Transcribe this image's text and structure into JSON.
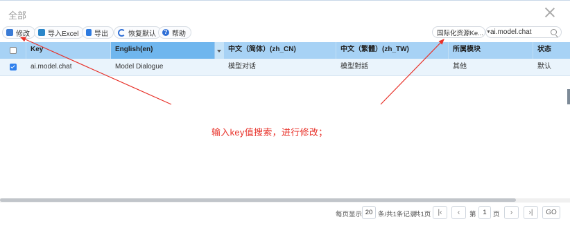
{
  "dialog": {
    "title": "全部"
  },
  "toolbar": {
    "edit": "修改",
    "import": "导入Excel",
    "export": "导出",
    "restore": "恢复默认",
    "help": "帮助"
  },
  "search": {
    "type_select": "国际化资源Ke...",
    "query": "ai.model.chat"
  },
  "table": {
    "headers": [
      "Key",
      "English(en)",
      "中文（简体）(zh_CN)",
      "中文（繁體）(zh_TW)",
      "所属模块",
      "状态"
    ],
    "rows": [
      {
        "checked": true,
        "cells": [
          "ai.model.chat",
          "Model Dialogue",
          "模型对话",
          "模型對話",
          "其他",
          "默认"
        ]
      }
    ]
  },
  "annotation": {
    "text": "输入key值搜索，进行修改；",
    "color": "#e8322a"
  },
  "pager": {
    "per_page_label": "每页显示",
    "per_page": "20",
    "records_label": "条/共1条记录",
    "total_pages": "共1页",
    "page_prefix": "第",
    "page": "1",
    "page_suffix": "页",
    "go": "GO"
  },
  "colors": {
    "header_bg": "#a7d2f5",
    "sorted_header_bg": "#6fb6ee",
    "row_selected_bg": "#eaf4fc",
    "accent": "#2f80ed"
  }
}
